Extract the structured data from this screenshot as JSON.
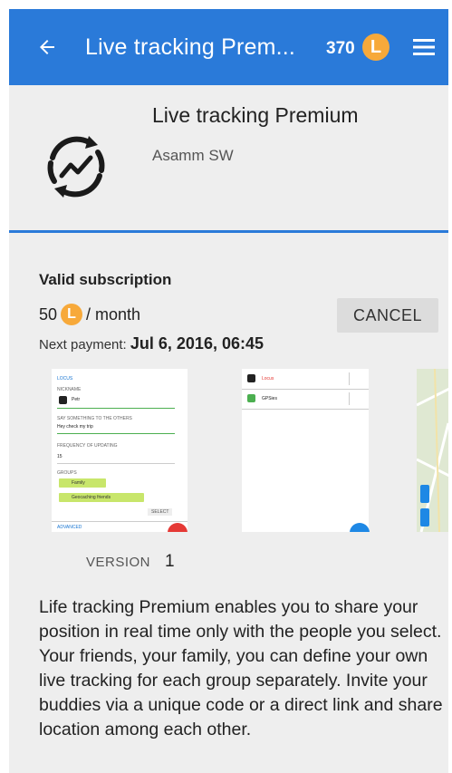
{
  "app_bar": {
    "title": "Live tracking Prem...",
    "credits": "370",
    "coin_letter": "L",
    "back_icon": "arrow-left-icon",
    "menu_icon": "hamburger-menu-icon",
    "color": "#2a7ad9"
  },
  "header": {
    "app_name": "Live tracking Premium",
    "author": "Asamm SW",
    "icon": "live-tracking-sync-icon"
  },
  "subscription": {
    "title": "Valid subscription",
    "price_amount": "50",
    "coin_letter": "L",
    "period": "/ month",
    "next_payment_label": "Next payment: ",
    "next_payment_date": "Jul 6, 2016, 06:45",
    "cancel_label": "CANCEL"
  },
  "screenshots": {
    "shot1": {
      "heading": "LOCUS",
      "nickname_label": "NICKNAME",
      "nickname": "Petr",
      "message_label": "SAY SOMETHING TO THE OTHERS",
      "message": "Hey check my trip",
      "frequency_label": "FREQUENCY OF UPDATING",
      "frequency": "15",
      "groups_label": "GROUPS",
      "group1": "Family",
      "group2": "Geocaching friends",
      "select_label": "SELECT",
      "advanced_label": "ADVANCED"
    },
    "shot2": {
      "row1": "Locus",
      "row2": "GPSies"
    }
  },
  "version": {
    "label": "VERSION",
    "value": "1"
  },
  "description": "Life tracking Premium enables you to share your position in real time only with the people you select. Your friends, your family, you can define your own live tracking for each group separately. Invite your buddies via a unique code or a direct link and share location among each other.",
  "colors": {
    "accent": "#2a7ad9",
    "coin": "#f7a93a",
    "background": "#eeeeee"
  }
}
